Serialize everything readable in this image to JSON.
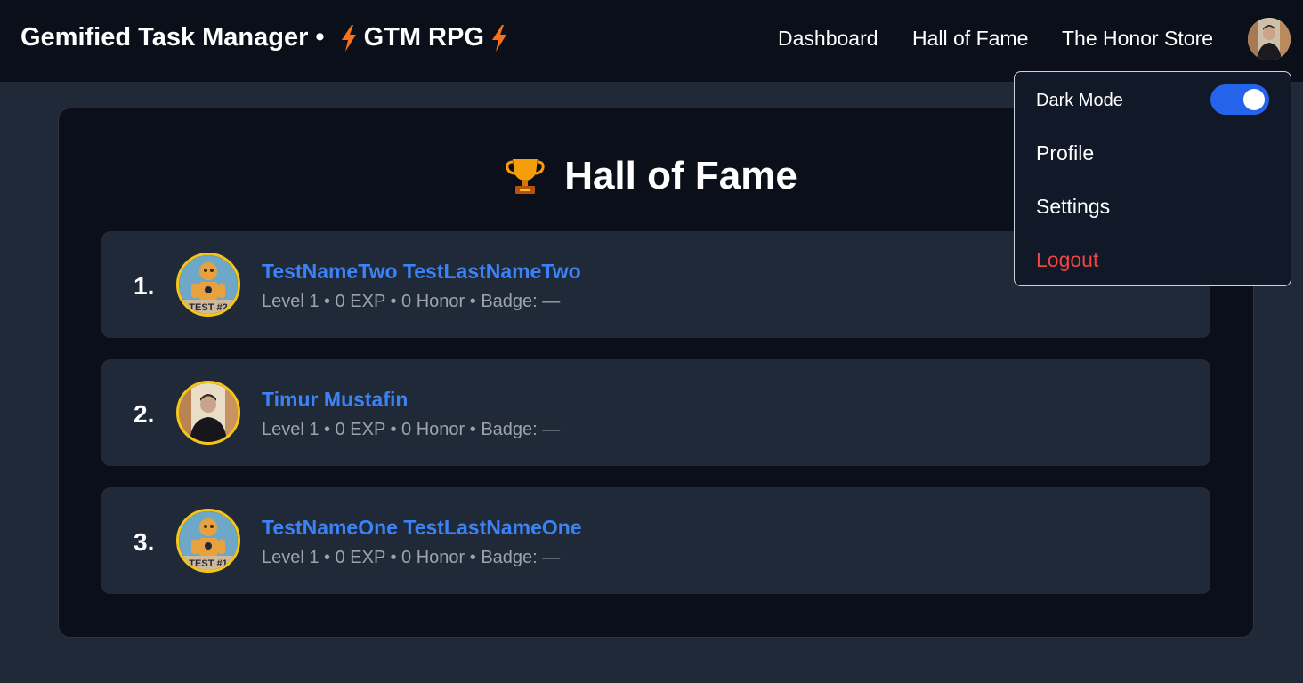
{
  "header": {
    "brand_title": "Gemified Task Manager",
    "brand_separator": "•",
    "brand_subtitle": "GTM RPG",
    "nav": {
      "dashboard": "Dashboard",
      "hall_of_fame": "Hall of Fame",
      "honor_store": "The Honor Store"
    },
    "avatar_icon": "user-avatar"
  },
  "main": {
    "title": "Hall of Fame",
    "title_icon": "trophy-icon",
    "leaderboard": [
      {
        "rank": "1.",
        "name": "TestNameTwo TestLastNameTwo",
        "stats": "Level 1 • 0 EXP • 0 Honor • Badge: —",
        "avatar_caption": "TEST #2"
      },
      {
        "rank": "2.",
        "name": "Timur Mustafin",
        "stats": "Level 1 • 0 EXP • 0 Honor • Badge: —"
      },
      {
        "rank": "3.",
        "name": "TestNameOne TestLastNameOne",
        "stats": "Level 1 • 0 EXP • 0 Honor • Badge: —",
        "avatar_caption": "TEST #1"
      }
    ]
  },
  "user_menu": {
    "dark_mode_label": "Dark Mode",
    "dark_mode_on": true,
    "profile": "Profile",
    "settings": "Settings",
    "logout": "Logout"
  },
  "colors": {
    "accent": "#2563eb",
    "link": "#3b82f6",
    "logout": "#ef4444",
    "avatar_border": "#f5c518",
    "bolt": "#f97316"
  }
}
